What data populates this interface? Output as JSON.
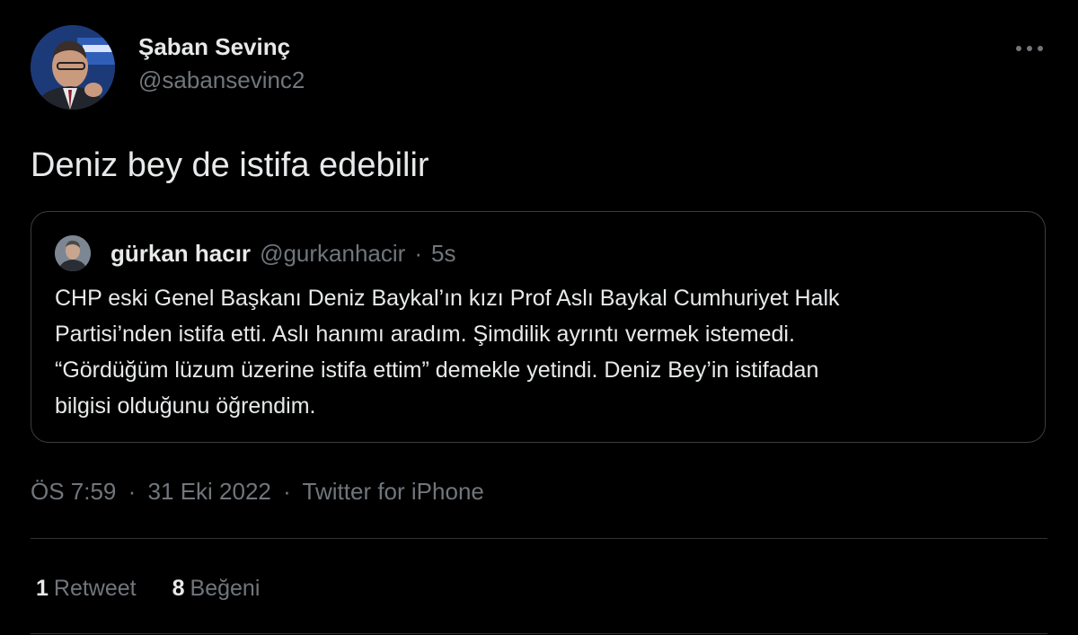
{
  "author": {
    "display_name": "Şaban Sevinç",
    "handle": "@sabansevinc2",
    "avatar_icon": "person-avatar"
  },
  "more_icon": "more-horizontal-icon",
  "tweet": {
    "text": "Deniz bey de istifa edebilir"
  },
  "quoted_tweet": {
    "display_name": "gürkan hacır",
    "handle": "@gurkanhacir",
    "separator": "·",
    "time": "5s",
    "body_lines": [
      "CHP eski Genel Başkanı Deniz Baykal’ın kızı Prof Aslı Baykal Cumhuriyet Halk",
      "Partisi’nden istifa etti. Aslı hanımı aradım. Şimdilik ayrıntı vermek istemedi.",
      "“Gördüğüm lüzum üzerine istifa ettim” demekle yetindi. Deniz Bey’in istifadan",
      "bilgisi olduğunu öğrendim."
    ]
  },
  "meta": {
    "time": "ÖS 7:59",
    "separator": "·",
    "date": "31 Eki 2022",
    "source": "Twitter for iPhone"
  },
  "stats": {
    "retweets_count": "1",
    "retweets_label": "Retweet",
    "likes_count": "8",
    "likes_label": "Beğeni"
  },
  "colors": {
    "background": "#000000",
    "primary_text": "#e7e9ea",
    "secondary_text": "#71767b",
    "border": "#2f3336"
  }
}
